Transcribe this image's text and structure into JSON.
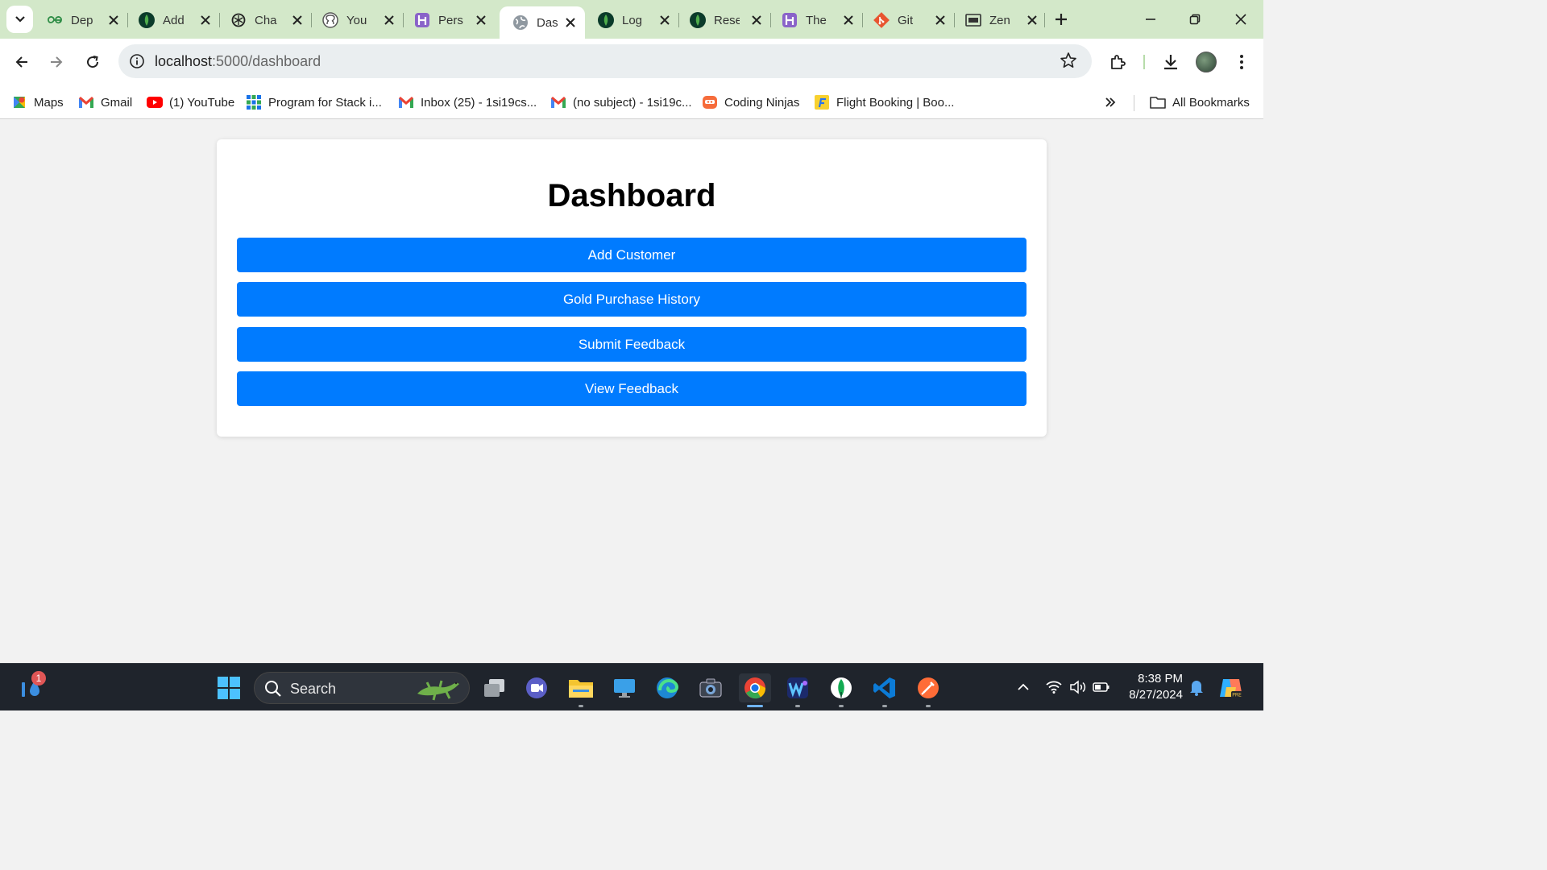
{
  "browser": {
    "tabs": [
      {
        "label": "Dep",
        "icon": "geeksforgeeks-icon"
      },
      {
        "label": "Add",
        "icon": "mongodb-leaf-icon"
      },
      {
        "label": "Cha",
        "icon": "chatgpt-icon"
      },
      {
        "label": "You",
        "icon": "github-icon"
      },
      {
        "label": "Pers",
        "icon": "hashnode-icon"
      },
      {
        "label": "Dasl",
        "icon": "globe-icon",
        "active": true
      },
      {
        "label": "Log",
        "icon": "mongodb-leaf-icon"
      },
      {
        "label": "Rese",
        "icon": "mongodb-leaf-icon"
      },
      {
        "label": "The",
        "icon": "hashnode-icon"
      },
      {
        "label": "Git",
        "icon": "git-icon"
      },
      {
        "label": "Zen",
        "icon": "zenclass-icon"
      }
    ],
    "address": {
      "host": "localhost",
      "path": ":5000/dashboard"
    },
    "bookmarks": [
      {
        "label": "Maps",
        "icon": "maps-icon"
      },
      {
        "label": "Gmail",
        "icon": "gmail-icon"
      },
      {
        "label": "(1) YouTube",
        "icon": "youtube-icon"
      },
      {
        "label": "Program for Stack i...",
        "icon": "gfg-grid-icon"
      },
      {
        "label": "Inbox (25) - 1si19cs...",
        "icon": "gmail-icon"
      },
      {
        "label": "(no subject) - 1si19c...",
        "icon": "gmail-icon"
      },
      {
        "label": "Coding Ninjas",
        "icon": "codingninjas-icon"
      },
      {
        "label": "Flight Booking | Boo...",
        "icon": "flipkart-icon"
      }
    ],
    "all_bookmarks_label": "All Bookmarks"
  },
  "dashboard": {
    "title": "Dashboard",
    "buttons": [
      "Add Customer",
      "Gold Purchase History",
      "Submit Feedback",
      "View Feedback"
    ],
    "button_color": "#007bff"
  },
  "taskbar": {
    "search_label": "Search",
    "notification_count": "1",
    "time": "8:38 PM",
    "date": "8/27/2024"
  }
}
